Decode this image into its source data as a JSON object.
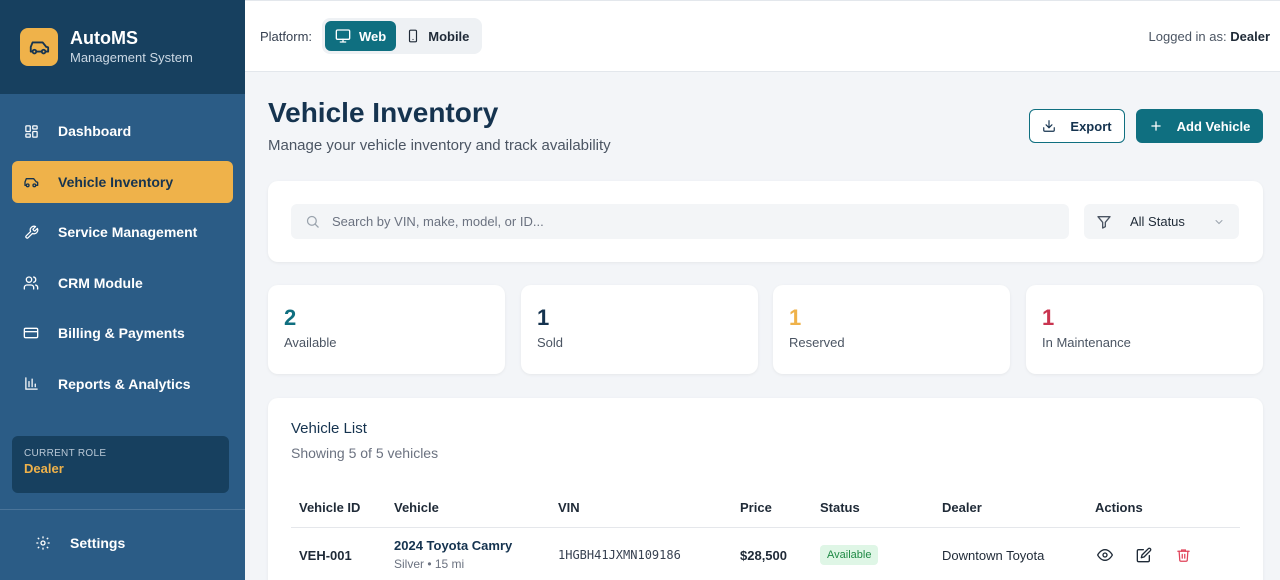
{
  "brand": {
    "name": "AutoMS",
    "subtitle": "Management System"
  },
  "sidebar": {
    "items": [
      {
        "label": "Dashboard",
        "icon": "grid-icon"
      },
      {
        "label": "Vehicle Inventory",
        "icon": "car-icon",
        "active": true
      },
      {
        "label": "Service Management",
        "icon": "wrench-icon"
      },
      {
        "label": "CRM Module",
        "icon": "users-icon"
      },
      {
        "label": "Billing & Payments",
        "icon": "credit-card-icon"
      },
      {
        "label": "Reports & Analytics",
        "icon": "bar-chart-icon"
      }
    ],
    "role": {
      "label": "CURRENT ROLE",
      "value": "Dealer"
    },
    "settings": "Settings"
  },
  "topbar": {
    "platform_label": "Platform:",
    "web_label": "Web",
    "mobile_label": "Mobile",
    "logged_prefix": "Logged in as:",
    "logged_user": "Dealer"
  },
  "header": {
    "title": "Vehicle Inventory",
    "subtitle": "Manage your vehicle inventory and track availability",
    "export_label": "Export",
    "add_label": "Add Vehicle"
  },
  "search": {
    "placeholder": "Search by VIN, make, model, or ID...",
    "status_filter": "All Status"
  },
  "stats": [
    {
      "value": "2",
      "label": "Available",
      "color": "#0f6f80"
    },
    {
      "value": "1",
      "label": "Sold",
      "color": "#15334f"
    },
    {
      "value": "1",
      "label": "Reserved",
      "color": "#efb24a"
    },
    {
      "value": "1",
      "label": "In Maintenance",
      "color": "#c9344f"
    }
  ],
  "list": {
    "title": "Vehicle List",
    "subtitle": "Showing 5 of 5 vehicles",
    "columns": [
      "Vehicle ID",
      "Vehicle",
      "VIN",
      "Price",
      "Status",
      "Dealer",
      "Actions"
    ],
    "rows": [
      {
        "id": "VEH-001",
        "name": "2024 Toyota Camry",
        "meta": "Silver • 15 mi",
        "vin": "1HGBH41JXMN109186",
        "price": "$28,500",
        "status": "Available",
        "dealer": "Downtown Toyota"
      }
    ]
  }
}
